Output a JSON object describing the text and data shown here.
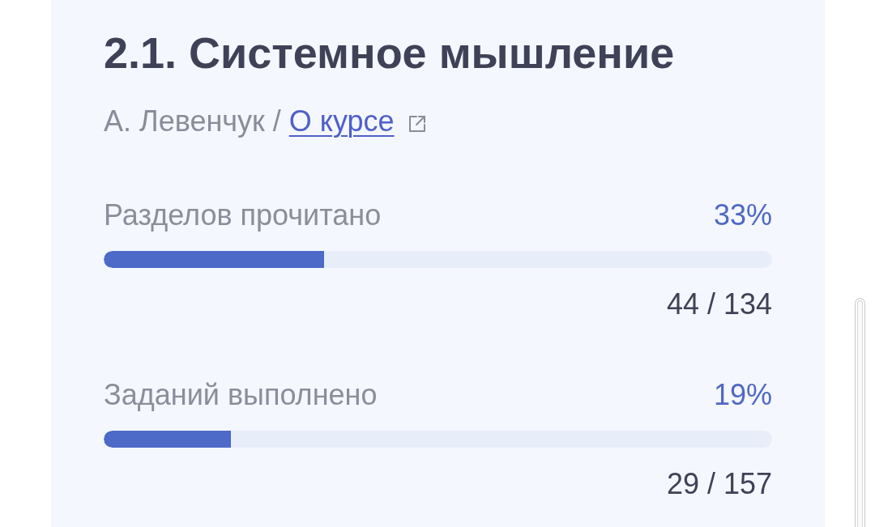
{
  "course": {
    "title": "2.1. Системное мышление",
    "author": "А. Левенчук /",
    "link": "О курсе"
  },
  "progress": [
    {
      "label": "Разделов прочитано",
      "percent": "33%",
      "level": 0.33,
      "count": "44 / 134"
    },
    {
      "label": "Заданий выполнено",
      "percent": "19%",
      "level": 0.19,
      "count": "29 / 157"
    }
  ]
}
